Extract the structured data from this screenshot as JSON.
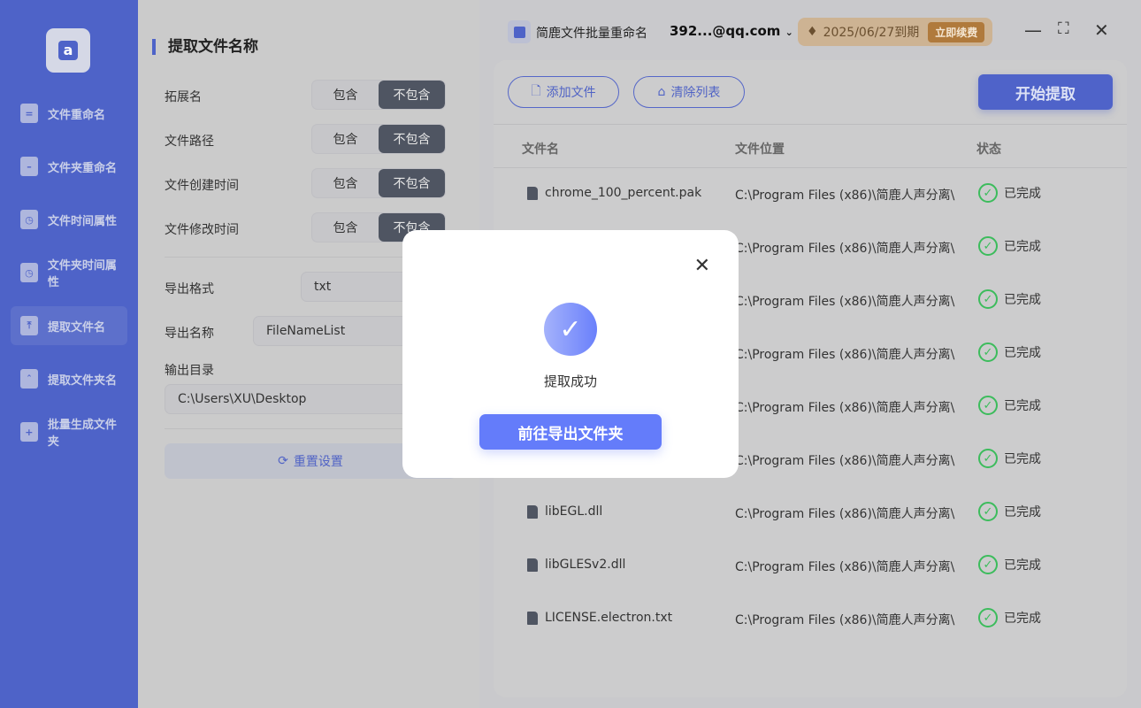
{
  "sidebar": {
    "items": [
      {
        "label": "文件重命名",
        "icon": "file-rename-icon"
      },
      {
        "label": "文件夹重命名",
        "icon": "folder-rename-icon"
      },
      {
        "label": "文件时间属性",
        "icon": "file-time-icon"
      },
      {
        "label": "文件夹时间属性",
        "icon": "folder-time-icon"
      },
      {
        "label": "提取文件名",
        "icon": "extract-file-icon",
        "active": true
      },
      {
        "label": "提取文件夹名",
        "icon": "extract-folder-icon"
      },
      {
        "label": "批量生成文件夹",
        "icon": "batch-folder-icon"
      }
    ]
  },
  "settings": {
    "title": "提取文件名称",
    "options": [
      {
        "label": "拓展名",
        "include": "包含",
        "exclude": "不包含",
        "selected": "exclude"
      },
      {
        "label": "文件路径",
        "include": "包含",
        "exclude": "不包含",
        "selected": "exclude"
      },
      {
        "label": "文件创建时间",
        "include": "包含",
        "exclude": "不包含",
        "selected": "exclude"
      },
      {
        "label": "文件修改时间",
        "include": "包含",
        "exclude": "不包含",
        "selected": "exclude"
      }
    ],
    "export_format_label": "导出格式",
    "export_format": "txt",
    "export_name_label": "导出名称",
    "export_name": "FileNameList",
    "output_dir_label": "输出目录",
    "output_dir": "C:\\Users\\XU\\Desktop",
    "reset_label": "重置设置"
  },
  "topbar": {
    "app_name": "简鹿文件批量重命名",
    "user": "392...@qq.com",
    "expiry": "2025/06/27到期",
    "renew": "立即续费"
  },
  "toolbar": {
    "add_file": "添加文件",
    "clear_list": "清除列表",
    "start": "开始提取"
  },
  "table": {
    "headers": [
      "文件名",
      "文件位置",
      "状态"
    ],
    "rows": [
      {
        "name": "chrome_100_percent.pak",
        "location": "C:\\Program Files (x86)\\简鹿人声分离\\",
        "status": "已完成"
      },
      {
        "name": "",
        "location": "C:\\Program Files (x86)\\简鹿人声分离\\",
        "status": "已完成"
      },
      {
        "name": "",
        "location": "C:\\Program Files (x86)\\简鹿人声分离\\",
        "status": "已完成"
      },
      {
        "name": "",
        "location": "C:\\Program Files (x86)\\简鹿人声分离\\",
        "status": "已完成"
      },
      {
        "name": "",
        "location": "C:\\Program Files (x86)\\简鹿人声分离\\",
        "status": "已完成"
      },
      {
        "name": "",
        "location": "C:\\Program Files (x86)\\简鹿人声分离\\",
        "status": "已完成"
      },
      {
        "name": "libEGL.dll",
        "location": "C:\\Program Files (x86)\\简鹿人声分离\\",
        "status": "已完成"
      },
      {
        "name": "libGLESv2.dll",
        "location": "C:\\Program Files (x86)\\简鹿人声分离\\",
        "status": "已完成"
      },
      {
        "name": "LICENSE.electron.txt",
        "location": "C:\\Program Files (x86)\\简鹿人声分离\\",
        "status": "已完成"
      }
    ]
  },
  "modal": {
    "message": "提取成功",
    "button": "前往导出文件夹"
  }
}
